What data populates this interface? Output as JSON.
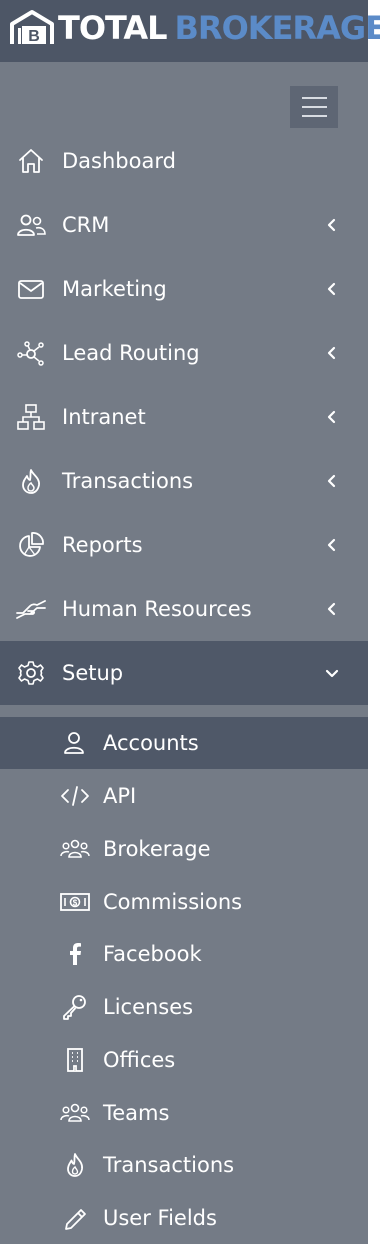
{
  "brand": {
    "name_part1": "TOTAL",
    "name_part2": "BROKERAGE",
    "colors": {
      "header_bg": "#4d5666",
      "sidebar_bg": "#747b86",
      "active_bg": "#4f5868",
      "accent_blue": "#5b8bc8"
    }
  },
  "menu_toggle": {
    "icon": "hamburger-icon"
  },
  "nav": {
    "items": [
      {
        "label": "Dashboard",
        "icon": "home-icon",
        "has_submenu": false
      },
      {
        "label": "CRM",
        "icon": "users-icon",
        "has_submenu": true,
        "expanded": false
      },
      {
        "label": "Marketing",
        "icon": "envelope-icon",
        "has_submenu": true,
        "expanded": false
      },
      {
        "label": "Lead Routing",
        "icon": "network-icon",
        "has_submenu": true,
        "expanded": false
      },
      {
        "label": "Intranet",
        "icon": "sitemap-icon",
        "has_submenu": true,
        "expanded": false
      },
      {
        "label": "Transactions",
        "icon": "flame-icon",
        "has_submenu": true,
        "expanded": false
      },
      {
        "label": "Reports",
        "icon": "pie-chart-icon",
        "has_submenu": true,
        "expanded": false
      },
      {
        "label": "Human Resources",
        "icon": "handshake-icon",
        "has_submenu": true,
        "expanded": false
      },
      {
        "label": "Setup",
        "icon": "gear-icon",
        "has_submenu": true,
        "expanded": true,
        "active": true
      }
    ]
  },
  "setup_submenu": {
    "items": [
      {
        "label": "Accounts",
        "icon": "user-icon",
        "active": true
      },
      {
        "label": "API",
        "icon": "code-icon"
      },
      {
        "label": "Brokerage",
        "icon": "group-icon"
      },
      {
        "label": "Commissions",
        "icon": "money-bill-icon"
      },
      {
        "label": "Facebook",
        "icon": "facebook-icon"
      },
      {
        "label": "Licenses",
        "icon": "key-icon"
      },
      {
        "label": "Offices",
        "icon": "building-icon"
      },
      {
        "label": "Teams",
        "icon": "group-icon"
      },
      {
        "label": "Transactions",
        "icon": "flame-icon"
      },
      {
        "label": "User Fields",
        "icon": "pencil-icon"
      }
    ]
  }
}
